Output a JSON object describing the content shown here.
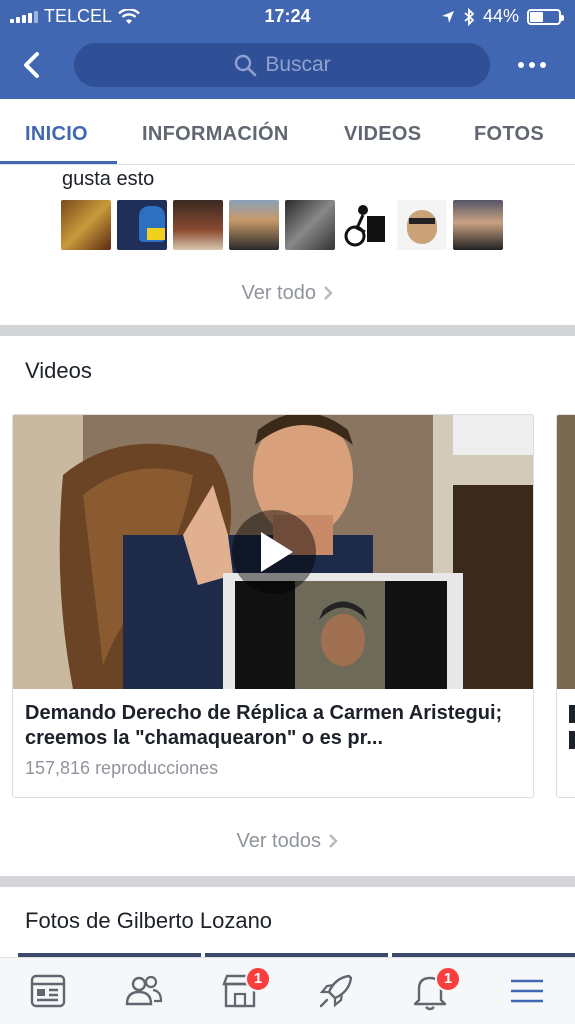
{
  "status_bar": {
    "carrier": "TELCEL",
    "time": "17:24",
    "battery_text": "44%",
    "battery_level": 0.44
  },
  "header": {
    "search_placeholder": "Buscar",
    "icons": [
      "back-icon",
      "search-icon",
      "more-icon"
    ]
  },
  "tabs": [
    {
      "label": "INICIO",
      "active": true
    },
    {
      "label": "INFORMACIÓN",
      "active": false
    },
    {
      "label": "VIDEOS",
      "active": false
    },
    {
      "label": "FOTOS",
      "active": false
    }
  ],
  "likes": {
    "text": "gusta esto",
    "see_all": "Ver todo"
  },
  "videos_section": {
    "title": "Videos",
    "card": {
      "title": "Demando Derecho de Réplica a Carmen Aristegui; creemos la \"chamaquearon\" o es pr...",
      "views": "157,816 reproducciones"
    },
    "see_all": "Ver todos"
  },
  "photos_section": {
    "title": "Fotos de Gilberto Lozano"
  },
  "bottom_nav": {
    "marketplace_badge": "1",
    "notifications_badge": "1"
  },
  "colors": {
    "brand_blue": "#4267b2",
    "badge_red": "#fa3e3e"
  }
}
